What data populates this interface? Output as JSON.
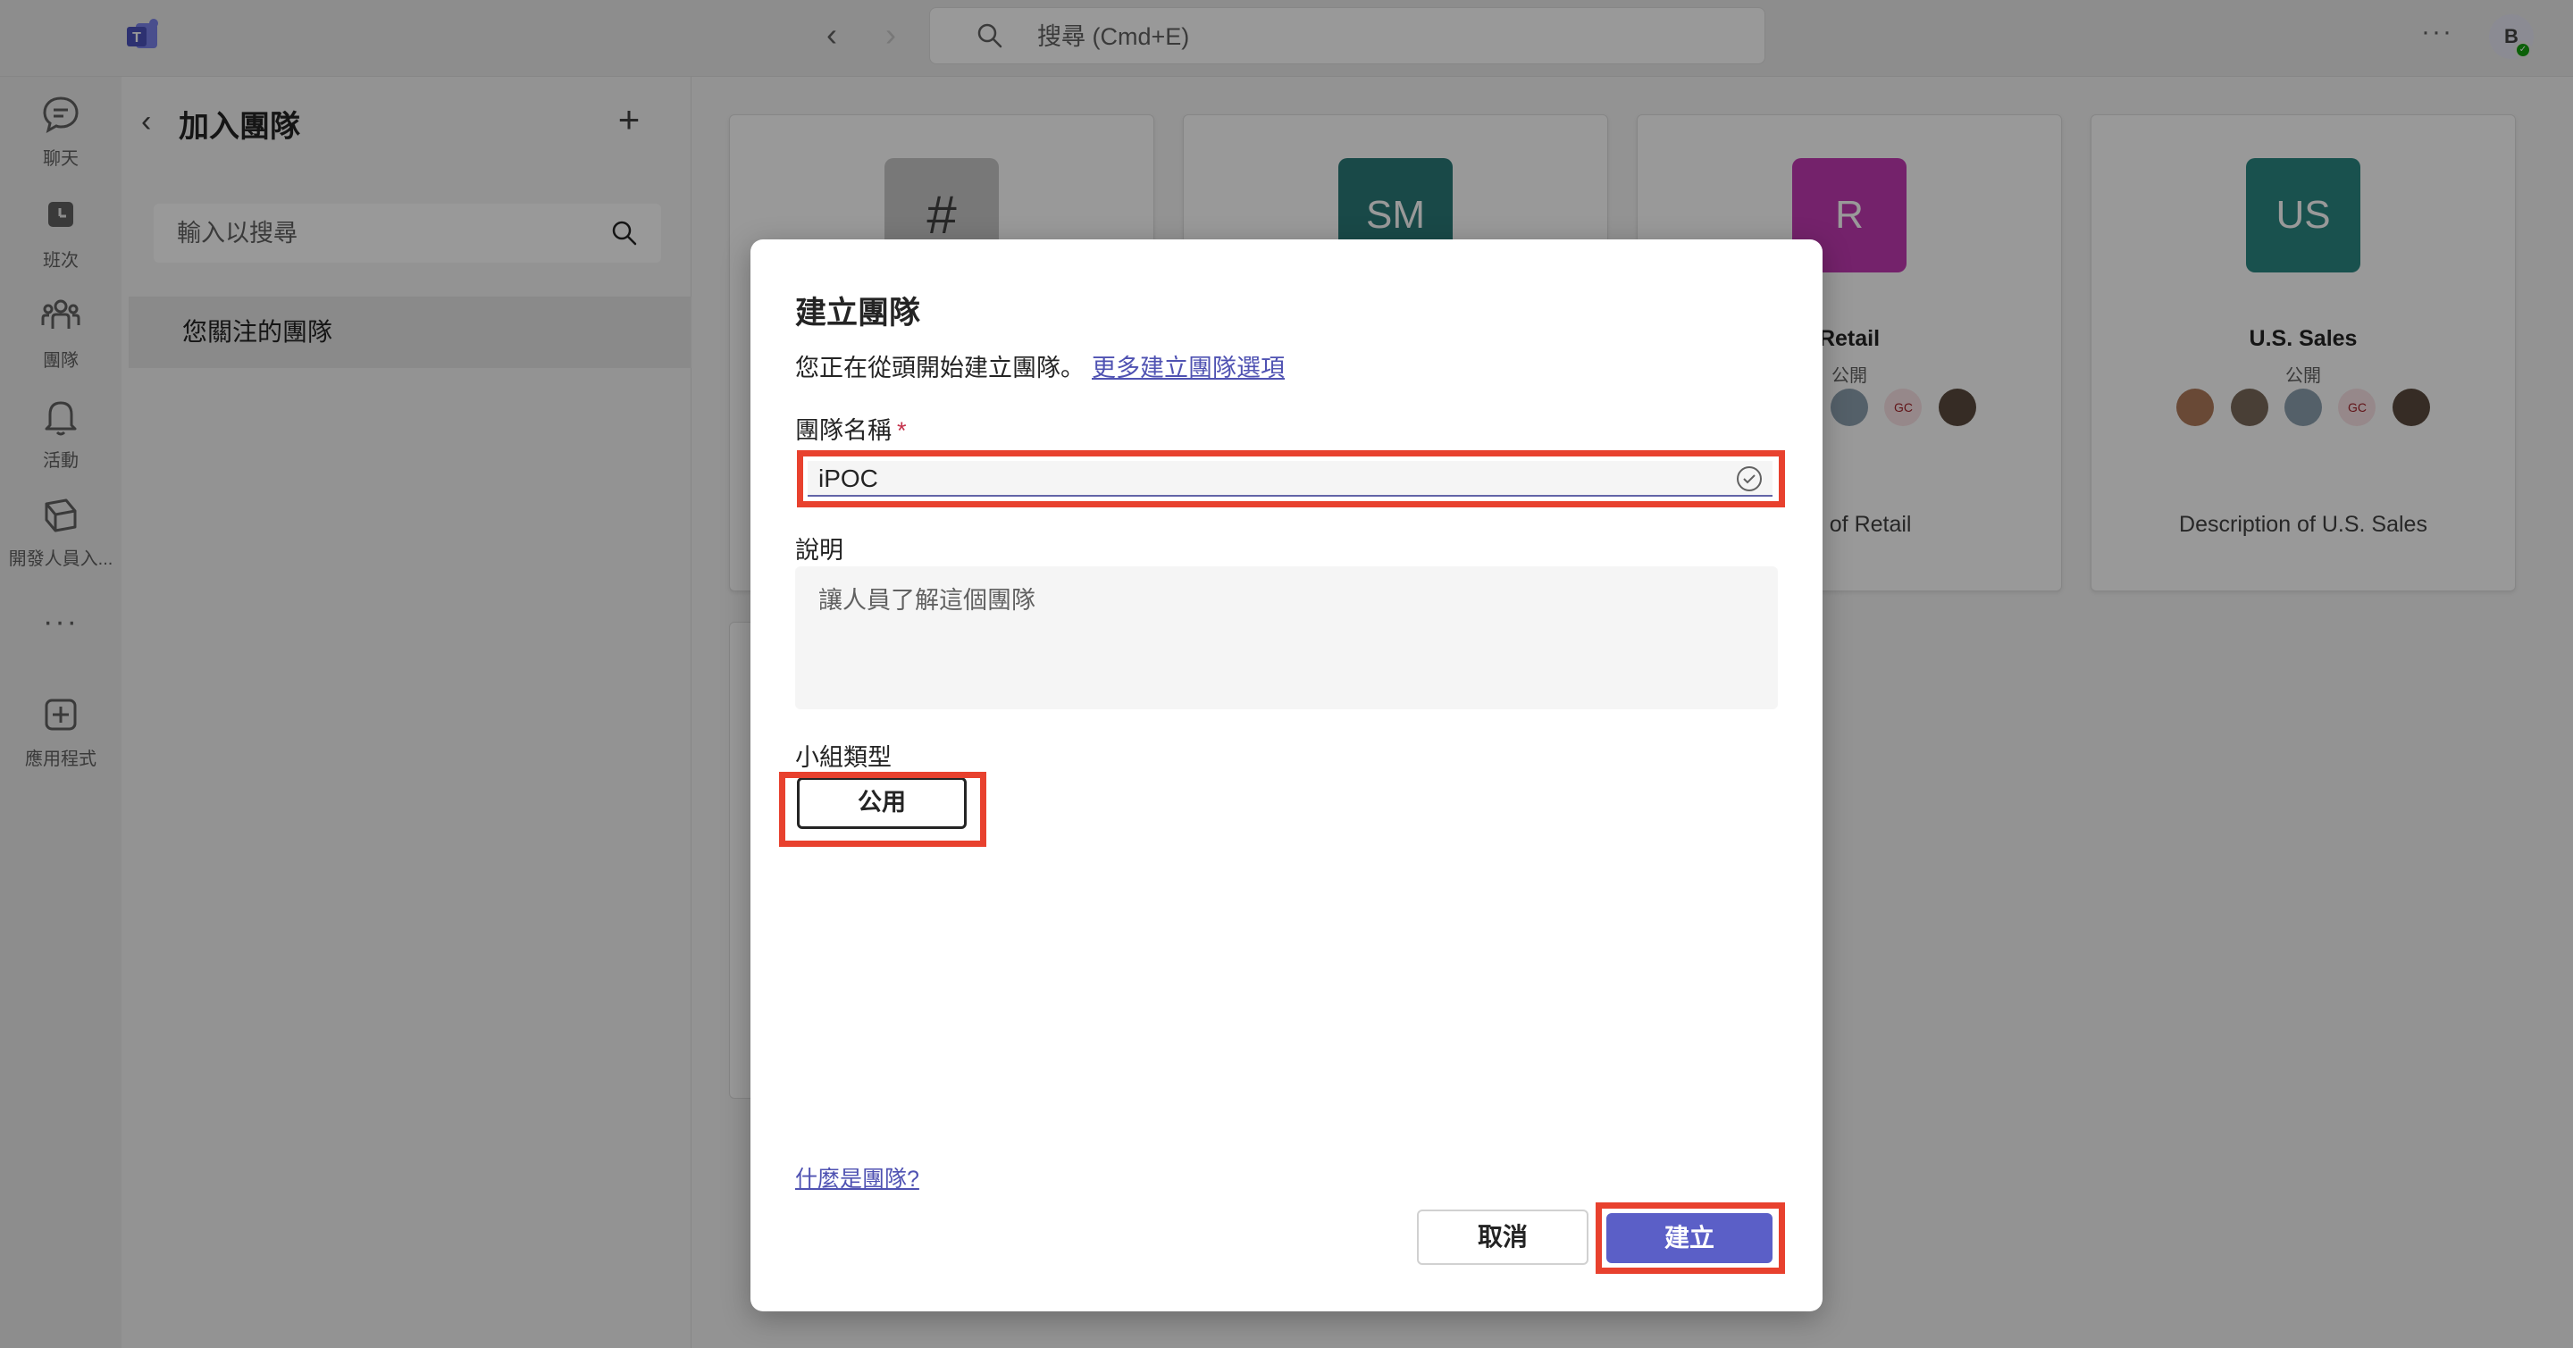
{
  "topbar": {
    "search_placeholder": "搜尋 (Cmd+E)",
    "more": "···",
    "avatar_initial": "B"
  },
  "rail": {
    "items": [
      {
        "label": "聊天",
        "icon": "chat-icon"
      },
      {
        "label": "班次",
        "icon": "shifts-icon"
      },
      {
        "label": "團隊",
        "icon": "teams-icon"
      },
      {
        "label": "活動",
        "icon": "bell-icon"
      },
      {
        "label": "開發人員入...",
        "icon": "developer-portal-icon"
      },
      {
        "label": "",
        "icon": "more-icon"
      },
      {
        "label": "應用程式",
        "icon": "add-app-icon"
      }
    ],
    "more": "···"
  },
  "side": {
    "back": "‹",
    "title": "加入團隊",
    "plus": "+",
    "search_placeholder": "輸入以搜尋",
    "followed_label": "您關注的團隊"
  },
  "cards": [
    {
      "tile": "#",
      "tile_color": "#c8c8c8",
      "name": "",
      "visibility": "",
      "description": ""
    },
    {
      "tile": "SM",
      "tile_color": "#2b7a78",
      "name": "",
      "visibility": "",
      "description": ""
    },
    {
      "tile": "R",
      "tile_color": "#c239b3",
      "name": "Retail",
      "visibility": "公開",
      "description": "tion of Retail"
    },
    {
      "tile": "US",
      "tile_color": "#2b8783",
      "name": "U.S. Sales",
      "visibility": "公開",
      "description": "Description of U.S. Sales"
    }
  ],
  "member_initials": "GC",
  "dialog": {
    "title": "建立團隊",
    "subtitle": "您正在從頭開始建立團隊。",
    "more_options_link": "更多建立團隊選項",
    "name_label": "團隊名稱",
    "required_mark": "*",
    "name_value": "iPOC",
    "description_label": "說明",
    "description_placeholder": "讓人員了解這個團隊",
    "type_label": "小組類型",
    "type_value": "公用",
    "help_link": "什麼是團隊?",
    "cancel_label": "取消",
    "create_label": "建立"
  },
  "colors": {
    "accent": "#5b5fc7",
    "highlight": "#e8412e",
    "link": "#4f52b2"
  }
}
